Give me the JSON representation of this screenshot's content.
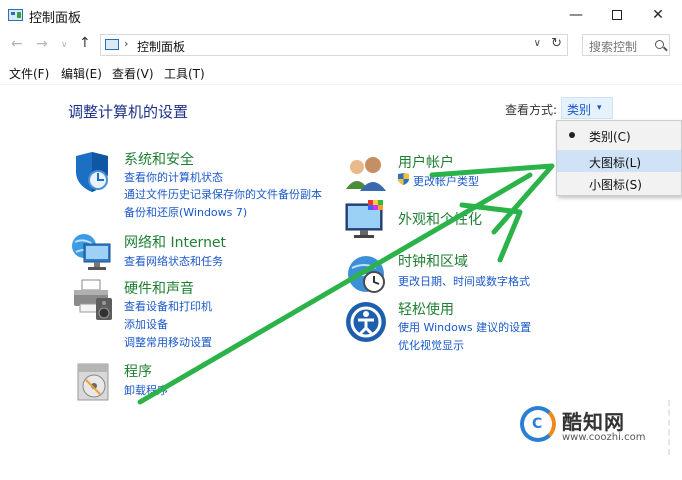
{
  "window": {
    "title": "控制面板",
    "minimize": "—",
    "close": "✕"
  },
  "nav": {
    "back": "←",
    "forward": "→",
    "recent": "∨",
    "up": "↑",
    "address_separator": "›",
    "address": "控制面板",
    "address_dropdown": "∨",
    "refresh": "↻",
    "search_placeholder": "搜索控制"
  },
  "menu": [
    "文件(F)",
    "编辑(E)",
    "查看(V)",
    "工具(T)"
  ],
  "content": {
    "title": "调整计算机的设置",
    "view_label": "查看方式:",
    "view_value": "类别",
    "view_arrow": "▾"
  },
  "categories": [
    {
      "title": "系统和安全",
      "icon": "shield-icon",
      "links": [
        "查看你的计算机状态",
        "通过文件历史记录保存你的文件备份副本",
        "备份和还原(Windows 7)"
      ]
    },
    {
      "title": "网络和 Internet",
      "icon": "network-globe-icon",
      "links": [
        "查看网络状态和任务"
      ]
    },
    {
      "title": "硬件和声音",
      "icon": "printer-icon",
      "links": [
        "查看设备和打印机",
        "添加设备",
        "调整常用移动设置"
      ]
    },
    {
      "title": "程序",
      "icon": "programs-disc-icon",
      "links": [
        "卸载程序"
      ]
    },
    {
      "title": "用户帐户",
      "icon": "users-icon",
      "links": [
        "更改帐户类型"
      ]
    },
    {
      "title": "外观和个性化",
      "icon": "monitor-color-icon",
      "links": []
    },
    {
      "title": "时钟和区域",
      "icon": "clock-globe-icon",
      "links": [
        "更改日期、时间或数字格式"
      ]
    },
    {
      "title": "轻松使用",
      "icon": "ease-of-access-icon",
      "links": [
        "使用 Windows 建议的设置",
        "优化视觉显示"
      ]
    }
  ],
  "dropdown": {
    "items": [
      "类别(C)",
      "大图标(L)",
      "小图标(S)"
    ],
    "selected_index": 0,
    "highlighted_index": 1
  },
  "watermark": {
    "name": "酷知网",
    "url": "www.coozhi.com",
    "logo": "C"
  },
  "colors": {
    "title_blue": "#1e3287",
    "link_blue": "#1a58c9",
    "category_green": "#1f7f33",
    "annotation_arrow": "#2bb34a"
  }
}
